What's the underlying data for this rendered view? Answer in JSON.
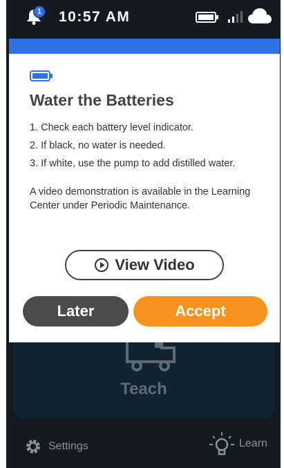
{
  "status_bar": {
    "notification_count": "1",
    "time": "10:57 AM",
    "icons": [
      "bell-icon",
      "battery-icon",
      "signal-icon",
      "cloud-icon"
    ]
  },
  "modal": {
    "header_color": "#2e72e6",
    "icon": "battery-icon",
    "title": "Water the Batteries",
    "steps": [
      "1. Check each battery level indicator.",
      "2. If black, no water is needed.",
      "3. If white, use the pump to add distilled water."
    ],
    "note": "A video demonstration is available in the Learning Center under Periodic Maintenance.",
    "view_video_label": "View Video",
    "later_label": "Later",
    "accept_label": "Accept",
    "accept_color": "#f7931e"
  },
  "background": {
    "teach_label": "Teach",
    "teach_icon": "robot-cart-icon"
  },
  "bottom_nav": {
    "settings_label": "Settings",
    "settings_icon": "gear-icon",
    "learn_label": "Learn",
    "learn_icon": "lightbulb-icon"
  }
}
